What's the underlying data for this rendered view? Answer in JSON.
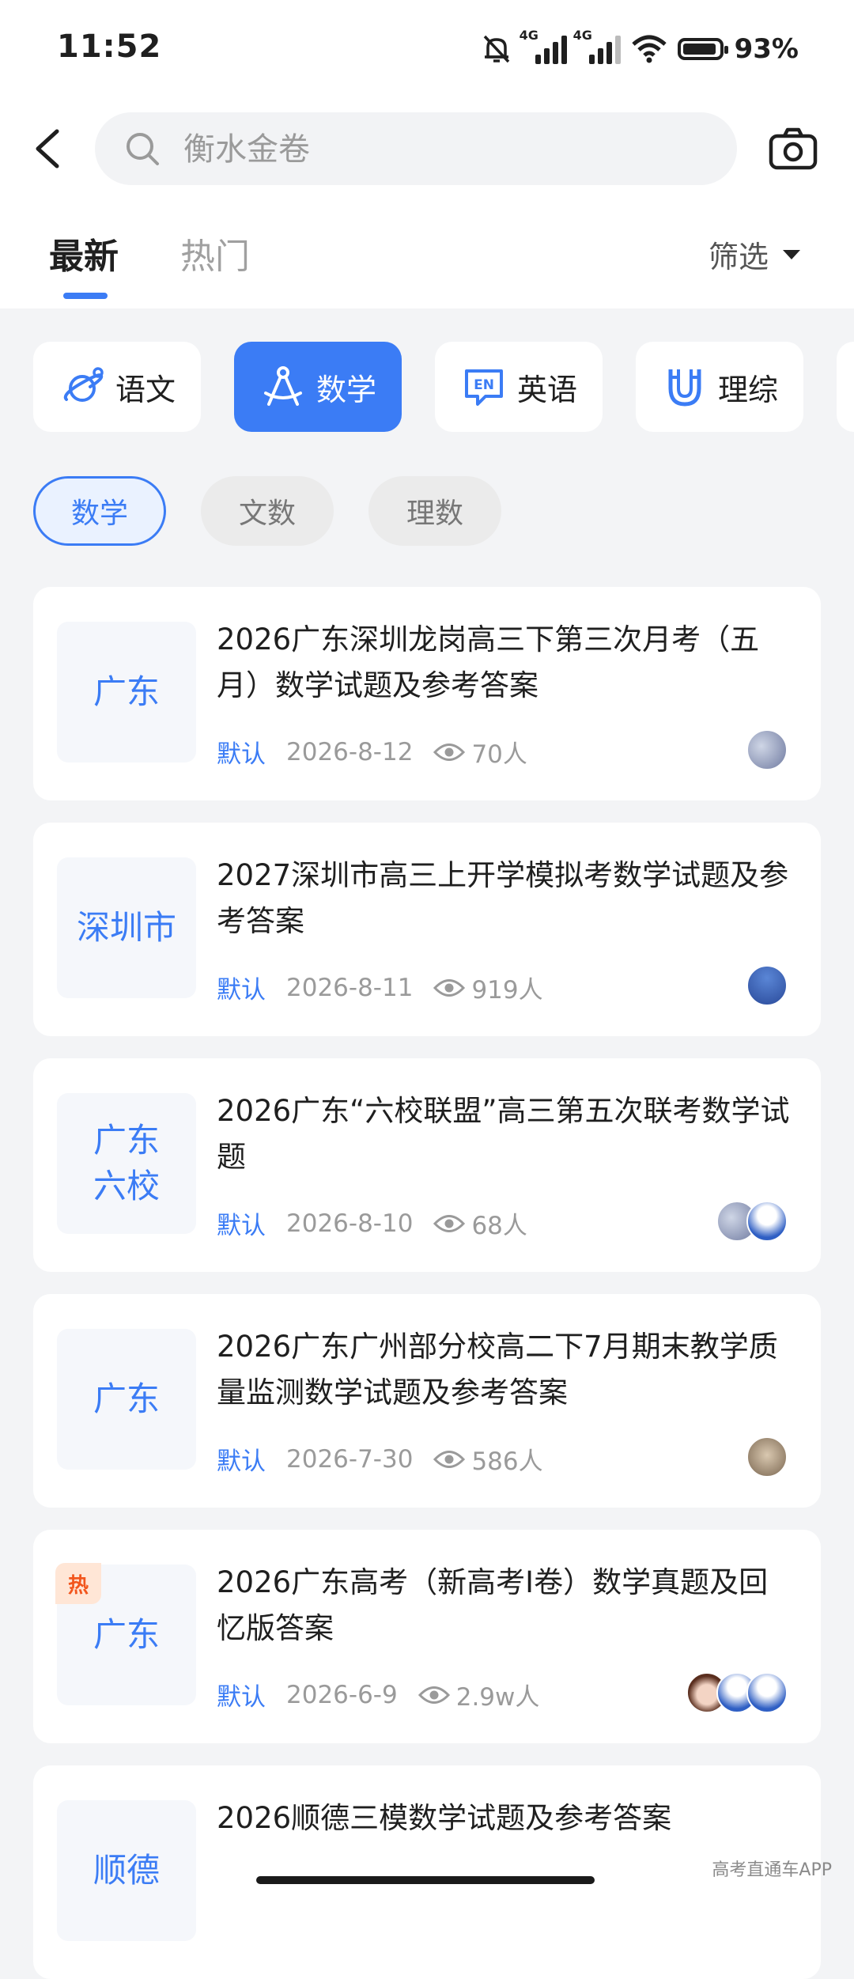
{
  "status_bar": {
    "time": "11:52",
    "network1": "4G",
    "network2": "4G",
    "battery_percent": "93%",
    "battery_level": 0.93
  },
  "search": {
    "placeholder": "衡水金卷"
  },
  "tabs": [
    {
      "label": "最新",
      "active": true
    },
    {
      "label": "热门",
      "active": false
    }
  ],
  "filter_label": "筛选",
  "subjects": [
    {
      "label": "语文",
      "icon": "planet-icon",
      "active": false
    },
    {
      "label": "数学",
      "icon": "compass-icon",
      "active": true
    },
    {
      "label": "英语",
      "icon": "en-icon",
      "active": false
    },
    {
      "label": "理综",
      "icon": "magnet-icon",
      "active": false
    }
  ],
  "subfilters": [
    {
      "label": "数学",
      "active": true
    },
    {
      "label": "文数",
      "active": false
    },
    {
      "label": "理数",
      "active": false
    }
  ],
  "items": [
    {
      "region": "广东",
      "title": "2026广东深圳龙岗高三下第三次月考（五月）数学试题及参考答案",
      "category": "默认",
      "date": "2026-8-12",
      "views": "70人",
      "hot": ""
    },
    {
      "region": "深圳市",
      "title": "2027深圳市高三上开学模拟考数学试题及参考答案",
      "category": "默认",
      "date": "2026-8-11",
      "views": "919人",
      "hot": ""
    },
    {
      "region": "广东\n六校",
      "title": "2026广东“六校联盟”高三第五次联考数学试题",
      "category": "默认",
      "date": "2026-8-10",
      "views": "68人",
      "hot": ""
    },
    {
      "region": "广东",
      "title": "2026广东广州部分校高二下7月期末教学质量监测数学试题及参考答案",
      "category": "默认",
      "date": "2026-7-30",
      "views": "586人",
      "hot": ""
    },
    {
      "region": "广东",
      "title": "2026广东高考（新高考I卷）数学真题及回忆版答案",
      "category": "默认",
      "date": "2026-6-9",
      "views": "2.9w人",
      "hot": "热"
    },
    {
      "region": "顺德",
      "title": "2026顺德三模数学试题及参考答案",
      "category": "",
      "date": "",
      "views": "",
      "hot": ""
    }
  ],
  "watermark": "高考直通车APP",
  "colors": {
    "accent": "#3b7cf5",
    "hot": "#f2561d"
  }
}
